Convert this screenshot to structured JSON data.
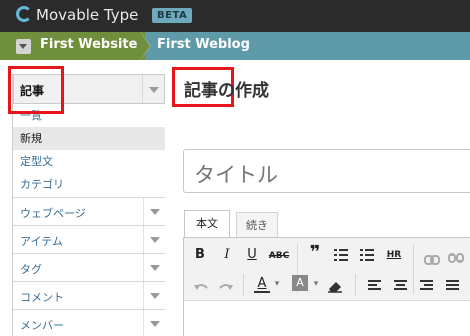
{
  "app": {
    "name": "Movable Type",
    "badge": "BETA"
  },
  "breadcrumb": {
    "website": "First Website",
    "blog": "First Weblog"
  },
  "sidebar": {
    "section_title": "記事",
    "sub_items": [
      "一覧",
      "新規",
      "定型文",
      "カテゴリ"
    ],
    "current_sub": "新規",
    "items": [
      "ウェブページ",
      "アイテム",
      "タグ",
      "コメント",
      "メンバー"
    ]
  },
  "main": {
    "page_title": "記事の作成",
    "title_placeholder": "タイトル",
    "tabs": [
      "本文",
      "続き"
    ],
    "active_tab": "本文"
  },
  "toolbar": {
    "bold": "B",
    "italic": "I",
    "underline": "U",
    "strike": "ABC",
    "quote": "❞",
    "hr": "HR",
    "text_color": "A",
    "bg_color": "A",
    "dropdown": "▾"
  },
  "colors": {
    "highlight": "#e8141b",
    "header_bg": "#2b2b2b",
    "crumb_site_bg": "#6f8f3d",
    "crumb_blog_bg": "#5f9aa8",
    "link": "#3a6e94"
  },
  "icons": [
    "site-menu-toggle-icon",
    "logo-icon",
    "link-icon",
    "unlink-icon",
    "undo-icon",
    "redo-icon",
    "eraser-icon"
  ]
}
